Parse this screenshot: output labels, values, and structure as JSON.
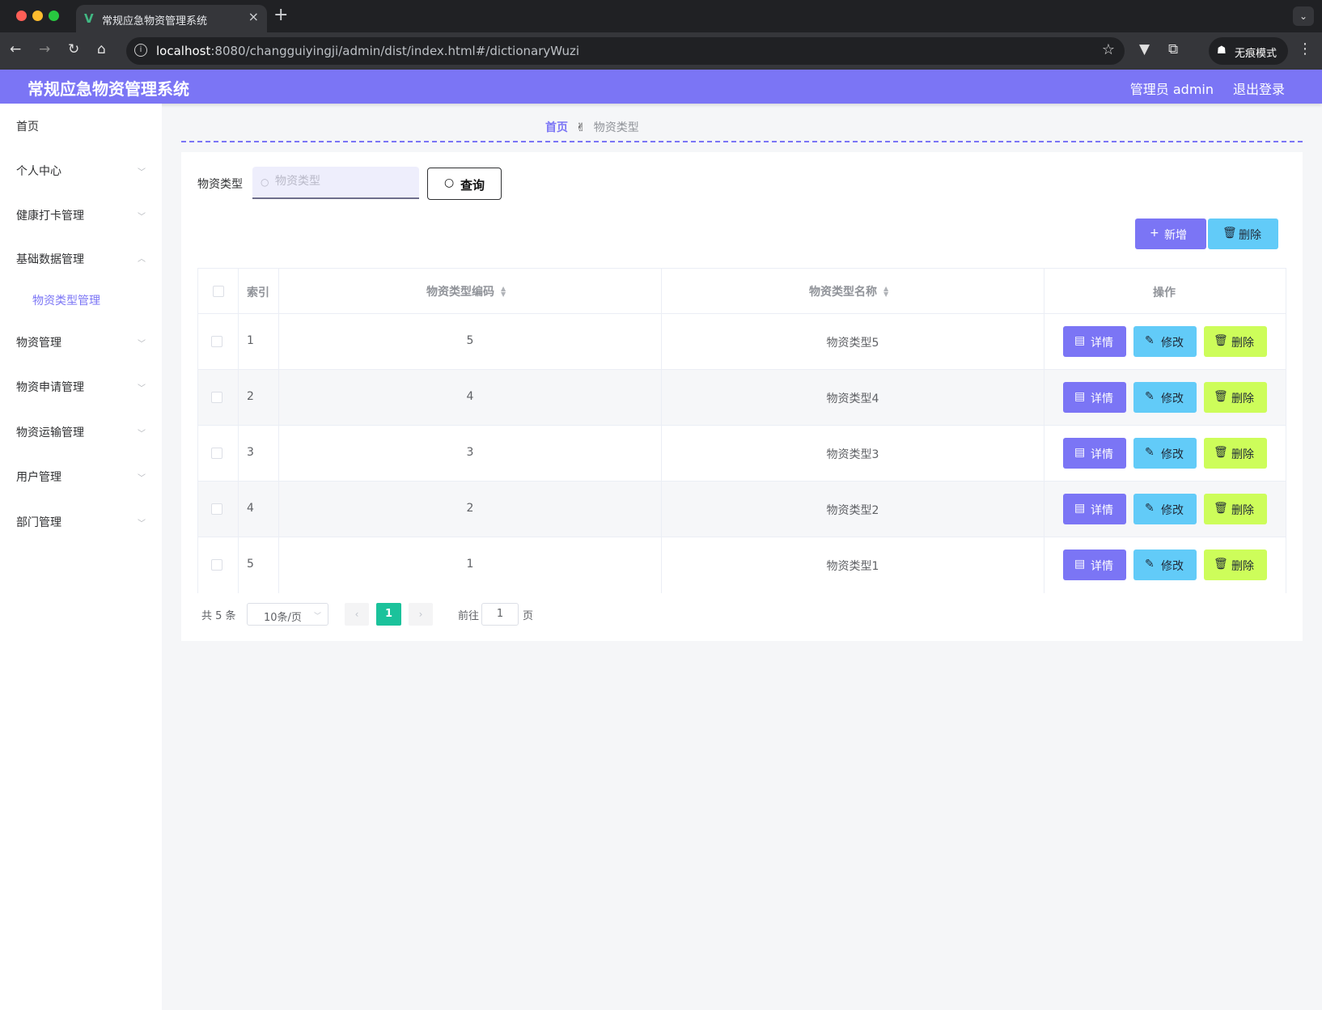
{
  "browser": {
    "tab_title": "常规应急物资管理系统",
    "url_host": "localhost",
    "url_path": ":8080/changguiyingji/admin/dist/index.html#/dictionaryWuzi",
    "incognito_label": "无痕模式",
    "icons": [
      "back-icon",
      "forward-icon",
      "reload-icon",
      "home-icon",
      "info-icon",
      "star-icon",
      "extension-icon",
      "incognito-icon",
      "menu-icon"
    ]
  },
  "header": {
    "title": "常规应急物资管理系统",
    "user": "管理员 admin",
    "logout": "退出登录"
  },
  "sidebar": {
    "items": [
      {
        "label": "首页"
      },
      {
        "label": "个人中心"
      },
      {
        "label": "健康打卡管理"
      },
      {
        "label": "基础数据管理"
      },
      {
        "label": "物资管理"
      },
      {
        "label": "物资申请管理"
      },
      {
        "label": "物资运输管理"
      },
      {
        "label": "用户管理"
      },
      {
        "label": "部门管理"
      }
    ],
    "sub_item": "物资类型管理",
    "active_color": "#7b75f5"
  },
  "breadcrumb": {
    "home": "首页",
    "current": "物资类型"
  },
  "search": {
    "label": "物资类型",
    "placeholder": "物资类型",
    "value": "",
    "button": "查询"
  },
  "actions": {
    "add": "新增",
    "delete": "删除"
  },
  "table": {
    "columns": [
      "索引",
      "物资类型编码",
      "物资类型名称",
      "操作"
    ],
    "rows": [
      {
        "index": "1",
        "code": "5",
        "name": "物资类型5"
      },
      {
        "index": "2",
        "code": "4",
        "name": "物资类型4"
      },
      {
        "index": "3",
        "code": "3",
        "name": "物资类型3"
      },
      {
        "index": "4",
        "code": "2",
        "name": "物资类型2"
      },
      {
        "index": "5",
        "code": "1",
        "name": "物资类型1"
      }
    ],
    "row_actions": {
      "detail": "详情",
      "edit": "修改",
      "delete": "删除"
    }
  },
  "pagination": {
    "total": "共 5 条",
    "page_size": "10条/页",
    "current_page": "1",
    "goto_label": "前往",
    "goto_value": "1",
    "page_suffix": "页"
  },
  "colors": {
    "primary": "#7b75f5",
    "info": "#62cbf8",
    "danger_btn": "#cdfd5a",
    "page_active": "#1bc29b"
  }
}
